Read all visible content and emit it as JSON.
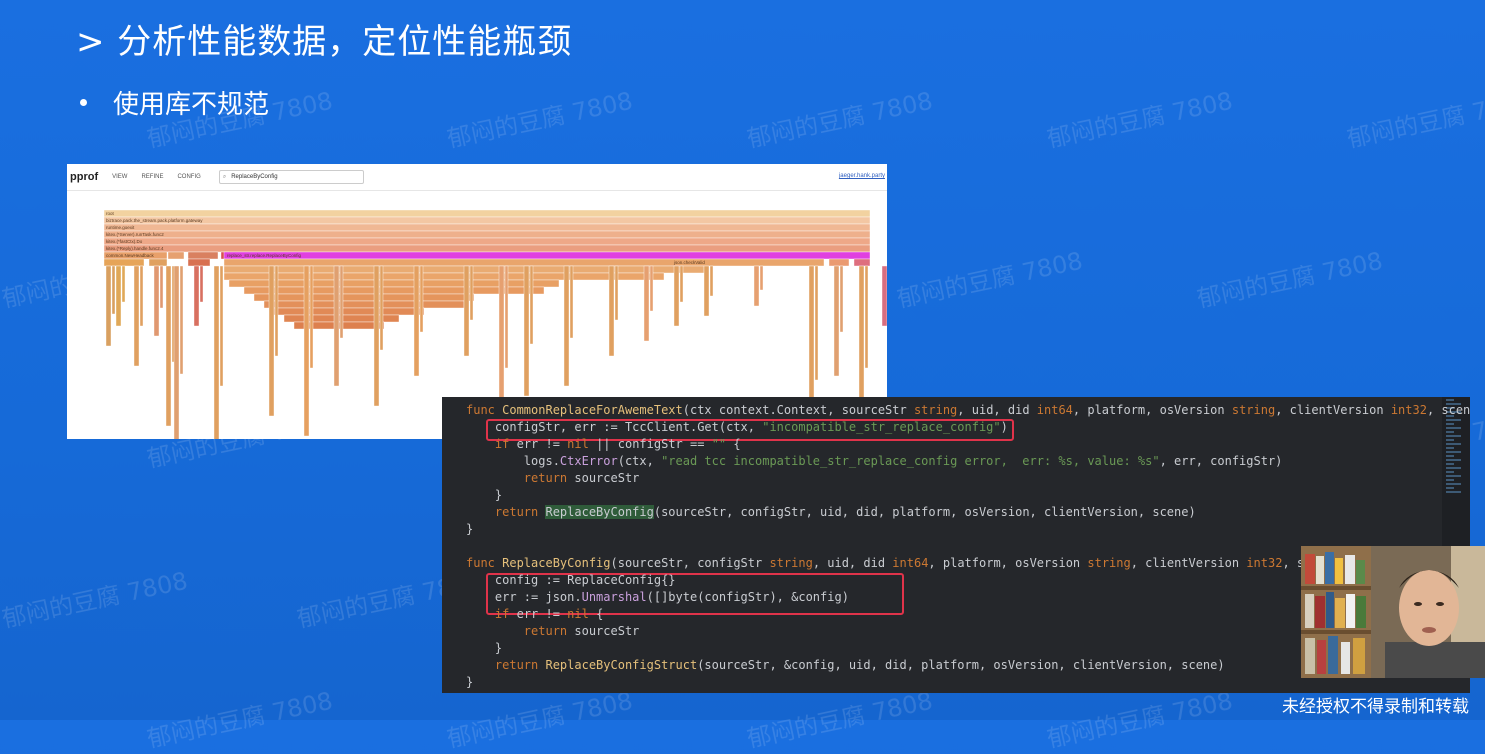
{
  "slide": {
    "title": "> 分析性能数据，定位性能瓶颈",
    "bullet": "使用库不规范",
    "watermark": "郁闷的豆腐 7808",
    "banner": "未经授权不得录制和转载"
  },
  "pprof": {
    "logo": "pprof",
    "menus": [
      "VIEW",
      "REFINE",
      "CONFIG"
    ],
    "search_value": "ReplaceByConfig",
    "top_link": "jaeger.hank.party",
    "frames": [
      "root",
      "biztrace.pack.the_stream.pack.platform.gateway",
      "runtime.goexit",
      "kitex.(*Server).runTask.func2",
      "kitex.(*fastCtx).Do",
      "kitex.(*Reply).handle.func2.4",
      "awme_hack.AwemeReplaceFunc",
      "common.NewHeadback",
      "replace_str.replace.ReplaceByConfig",
      "json.checkValid"
    ]
  },
  "code": {
    "lines": [
      [
        {
          "t": "func ",
          "c": "kw"
        },
        {
          "t": "CommonReplaceForAwemeText",
          "c": "fn"
        },
        {
          "t": "(ctx context.Context, sourceStr "
        },
        {
          "t": "string",
          "c": "ty"
        },
        {
          "t": ", uid, did "
        },
        {
          "t": "int64",
          "c": "ty"
        },
        {
          "t": ", platform, osVersion "
        },
        {
          "t": "string",
          "c": "ty"
        },
        {
          "t": ", clientVersion "
        },
        {
          "t": "int32",
          "c": "ty"
        },
        {
          "t": ", scene R"
        }
      ],
      [
        {
          "t": "    configStr, err := TccClient.Get(ctx, "
        },
        {
          "t": "\"incompatible_str_replace_config\"",
          "c": "st"
        },
        {
          "t": ")"
        }
      ],
      [
        {
          "t": "    "
        },
        {
          "t": "if ",
          "c": "kw"
        },
        {
          "t": "err != "
        },
        {
          "t": "nil",
          "c": "kw"
        },
        {
          "t": " || configStr == "
        },
        {
          "t": "\"\"",
          "c": "st"
        },
        {
          "t": " {"
        }
      ],
      [
        {
          "t": "        logs."
        },
        {
          "t": "CtxError",
          "c": "mt"
        },
        {
          "t": "(ctx, "
        },
        {
          "t": "\"read tcc incompatible_str_replace_config error,  err: %s, value: %s\"",
          "c": "st"
        },
        {
          "t": ", err, configStr)"
        }
      ],
      [
        {
          "t": "        "
        },
        {
          "t": "return ",
          "c": "kw"
        },
        {
          "t": "sourceStr"
        }
      ],
      [
        {
          "t": "    }"
        }
      ],
      [
        {
          "t": "    "
        },
        {
          "t": "return ",
          "c": "kw"
        },
        {
          "t": "ReplaceByConfig",
          "c": "hl"
        },
        {
          "t": "(sourceStr, configStr, uid, did, platform, osVersion, clientVersion, scene)"
        }
      ],
      [
        {
          "t": "}"
        }
      ],
      [
        {
          "t": ""
        }
      ],
      [
        {
          "t": "func ",
          "c": "kw"
        },
        {
          "t": "ReplaceByConfig",
          "c": "fn"
        },
        {
          "t": "(sourceStr, configStr "
        },
        {
          "t": "string",
          "c": "ty"
        },
        {
          "t": ", uid, did "
        },
        {
          "t": "int64",
          "c": "ty"
        },
        {
          "t": ", platform, osVersion "
        },
        {
          "t": "string",
          "c": "ty"
        },
        {
          "t": ", clientVersion "
        },
        {
          "t": "int32",
          "c": "ty"
        },
        {
          "t": ", scene R"
        }
      ],
      [
        {
          "t": "    config := ReplaceConfig{}"
        }
      ],
      [
        {
          "t": "    err := json."
        },
        {
          "t": "Unmarshal",
          "c": "mt"
        },
        {
          "t": "([]byte(configStr), &config)"
        }
      ],
      [
        {
          "t": "    "
        },
        {
          "t": "if ",
          "c": "kw"
        },
        {
          "t": "err != "
        },
        {
          "t": "nil",
          "c": "kw"
        },
        {
          "t": " {"
        }
      ],
      [
        {
          "t": "        "
        },
        {
          "t": "return ",
          "c": "kw"
        },
        {
          "t": "sourceStr"
        }
      ],
      [
        {
          "t": "    }"
        }
      ],
      [
        {
          "t": "    "
        },
        {
          "t": "return ",
          "c": "kw"
        },
        {
          "t": "ReplaceByConfigStruct",
          "c": "fn"
        },
        {
          "t": "(sourceStr, &config, uid, did, platform, osVersion, clientVersion, scene)"
        }
      ],
      [
        {
          "t": "}"
        }
      ]
    ]
  },
  "colors": {
    "background": "#166ad8",
    "highlight_box": "#e0334a",
    "flame_highlight": "#e040e0"
  }
}
